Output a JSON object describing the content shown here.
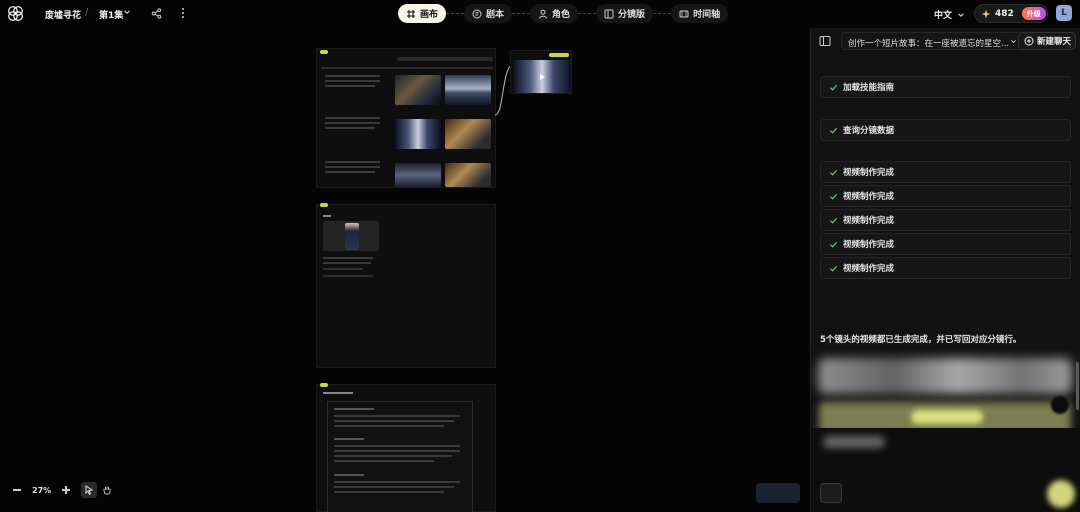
{
  "topbar": {
    "project_name": "废墟寻花",
    "separator": "/",
    "episode": "第1集"
  },
  "tabs": [
    {
      "label": "画布",
      "icon": "canvas-icon",
      "active": true
    },
    {
      "label": "剧本",
      "icon": "script-icon",
      "active": false
    },
    {
      "label": "角色",
      "icon": "person-icon",
      "active": false
    },
    {
      "label": "分镜版",
      "icon": "storyboard-icon",
      "active": false
    },
    {
      "label": "时间轴",
      "icon": "timeline-icon",
      "active": false
    }
  ],
  "language": "中文",
  "credits": {
    "value": "482",
    "upgrade_label": "升级"
  },
  "avatar_letter": "L",
  "zoom": {
    "level": "27%"
  },
  "chat": {
    "title": "创作一个短片故事：在一座被遗忘的星空...",
    "new_chat_label": "新建聊天",
    "steps": [
      {
        "label": "加载技能指南"
      },
      {
        "label": "查询分镜数据"
      },
      {
        "label": "视频制作完成"
      },
      {
        "label": "视频制作完成"
      },
      {
        "label": "视频制作完成"
      },
      {
        "label": "视频制作完成"
      },
      {
        "label": "视频制作完成"
      }
    ],
    "summary": "5个镜头的视频都已生成完成，并已写回对应分镜行。"
  },
  "colors": {
    "active_tab_bg": "#f7f4ea",
    "check_green": "#4ed37a",
    "upgrade_gradient_start": "#ff7a3c",
    "upgrade_gradient_end": "#b44bff"
  }
}
